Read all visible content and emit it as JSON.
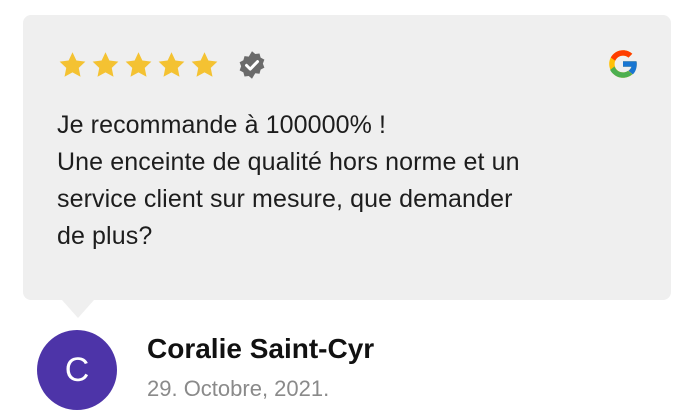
{
  "review": {
    "rating": 5,
    "max_rating": 5,
    "verified": true,
    "source_icon": "google-icon",
    "text_lines": [
      "Je recommande à 100000% !",
      "Une enceinte de qualité hors norme et un",
      "service client sur mesure, que demander",
      "de plus?"
    ]
  },
  "author": {
    "initial": "C",
    "name": "Coralie Saint-Cyr",
    "date": "29. Octobre, 2021."
  },
  "colors": {
    "card_background": "#efefef",
    "star": "#f4c232",
    "verified_badge": "#6a6a6a",
    "avatar": "#4d34a8",
    "google_blue": "#4285F4",
    "google_red": "#EA4335",
    "google_yellow": "#FBBC05",
    "google_green": "#34A853"
  },
  "icons": {
    "star": "star-icon",
    "verified": "verified-badge-icon",
    "source": "google-logo-icon"
  }
}
